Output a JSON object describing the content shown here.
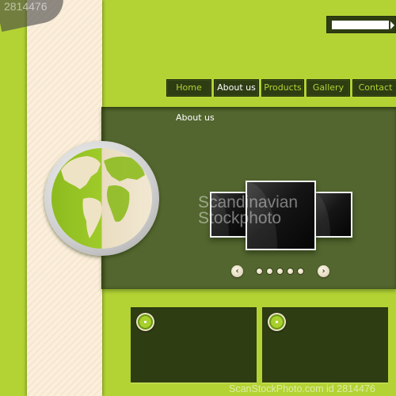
{
  "search": {
    "value": "",
    "placeholder": "",
    "submit_icon": "triangle-right-icon"
  },
  "nav": {
    "items": [
      {
        "label": "Home",
        "active": false
      },
      {
        "label": "About us",
        "active": true
      },
      {
        "label": "Products",
        "active": false
      },
      {
        "label": "Gallery",
        "active": false
      },
      {
        "label": "Contact",
        "active": false
      }
    ]
  },
  "hero": {
    "title": "About us",
    "globe_icon": "globe-icon",
    "slider": {
      "prev_icon": "chevron-left-icon",
      "next_icon": "chevron-right-icon",
      "prev_glyph": "‹",
      "next_glyph": "›",
      "dot_count": 5
    }
  },
  "boxes": [
    {
      "icon": "bullet-circle-icon"
    },
    {
      "icon": "bullet-circle-icon"
    }
  ],
  "watermark": {
    "top_text": "2814476",
    "center_line1": "Scandinavian",
    "center_line2": "Stockphoto",
    "bottom_text": "ScanStockPhoto.com id 2814476"
  },
  "colors": {
    "background": "#b3d334",
    "hero": "#53662f",
    "dark_panel": "#2e3d12",
    "stripe": "#fbefdc",
    "nav_text": "#b3d334",
    "nav_active_text": "#ffffff"
  }
}
